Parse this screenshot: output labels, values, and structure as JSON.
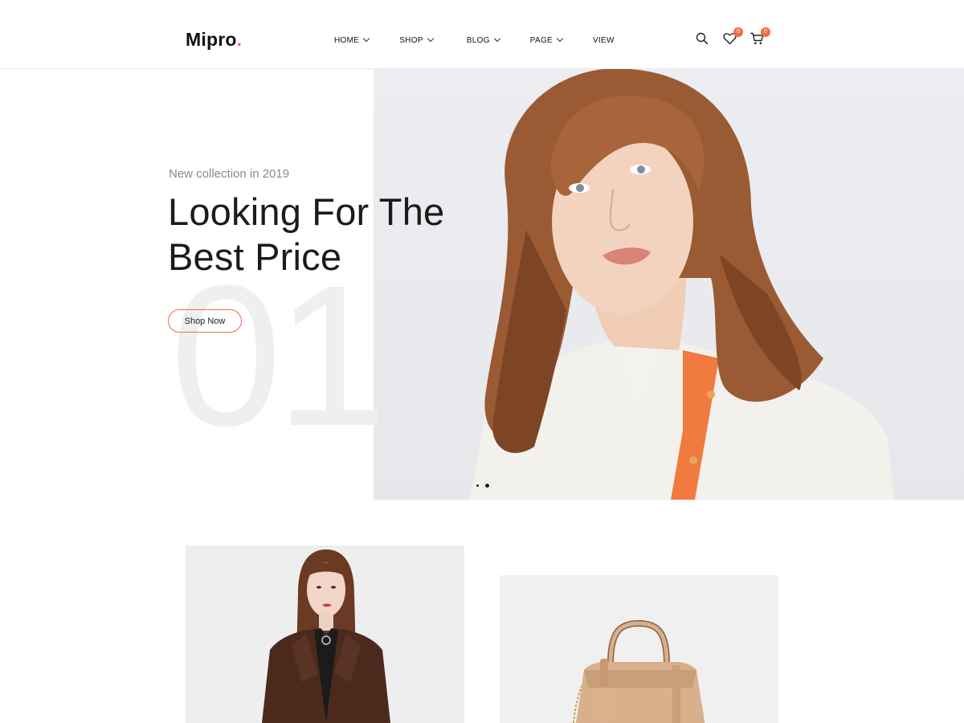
{
  "brand": {
    "name": "Mipro",
    "dot": ".",
    "accent": "#f26b48"
  },
  "nav": {
    "items": [
      {
        "label": "HOME",
        "dropdown": true
      },
      {
        "label": "SHOP",
        "dropdown": true
      },
      {
        "label": "BLOG",
        "dropdown": true
      },
      {
        "label": "PAGE",
        "dropdown": true
      },
      {
        "label": "VIEW",
        "dropdown": false
      }
    ]
  },
  "header_icons": {
    "search": "search-icon",
    "wishlist": {
      "icon": "heart-icon",
      "count": "0"
    },
    "cart": {
      "icon": "cart-icon",
      "count": "0"
    }
  },
  "hero": {
    "subtitle": "New collection in 2019",
    "headline": "Looking For The Best Price",
    "button": "Shop Now",
    "slide_number": "01",
    "slides_total": 2,
    "active_slide": 2
  },
  "products": [
    {
      "image": "woman-brown-coat"
    },
    {
      "image": "beige-handbag"
    }
  ]
}
